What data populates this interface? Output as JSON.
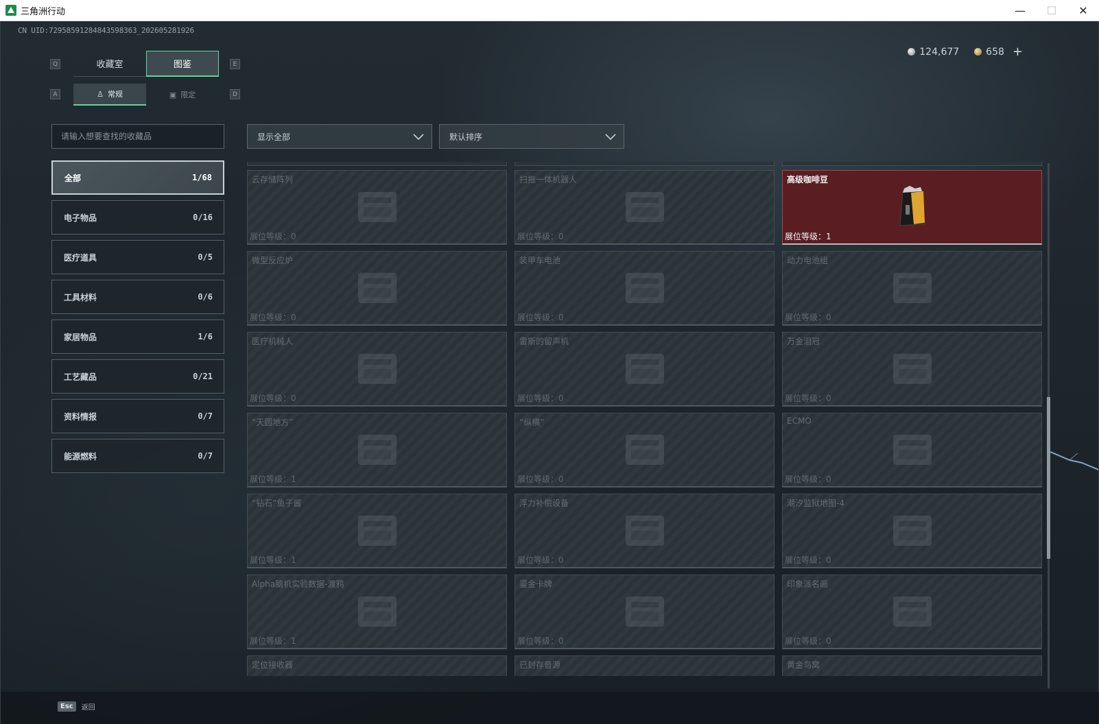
{
  "window": {
    "title": "三角洲行动",
    "minimize": "—",
    "maximize": "☐",
    "close": "✕"
  },
  "uid": "CN UID:72958591284843598363_202605281926",
  "currency": {
    "silver": "124,677",
    "gold": "658",
    "add": "+"
  },
  "keys": {
    "prev_tab": "Q",
    "next_tab": "E",
    "prev_sub": "A",
    "next_sub": "D",
    "back": "Esc"
  },
  "tabs": [
    {
      "label": "收藏室",
      "active": false
    },
    {
      "label": "图鉴",
      "active": true
    }
  ],
  "subtabs": [
    {
      "label": "常规",
      "icon": "figure-icon",
      "active": true
    },
    {
      "label": "限定",
      "icon": "image-icon",
      "active": false
    }
  ],
  "search": {
    "placeholder": "请输入想要查找的收藏品",
    "value": ""
  },
  "filters": {
    "display": "显示全部",
    "sort": "默认排序"
  },
  "categories": [
    {
      "label": "全部",
      "count": "1/68",
      "active": true
    },
    {
      "label": "电子物品",
      "count": "0/16",
      "active": false
    },
    {
      "label": "医疗道具",
      "count": "0/5",
      "active": false
    },
    {
      "label": "工具材料",
      "count": "0/6",
      "active": false
    },
    {
      "label": "家居物品",
      "count": "1/6",
      "active": false
    },
    {
      "label": "工艺藏品",
      "count": "0/21",
      "active": false
    },
    {
      "label": "资料情报",
      "count": "0/7",
      "active": false
    },
    {
      "label": "能源燃料",
      "count": "0/7",
      "active": false
    }
  ],
  "items": [
    {
      "name": "云存储阵列",
      "level": "展位等级：0",
      "owned": false,
      "icon": "server-icon"
    },
    {
      "name": "扫拖一体机器人",
      "level": "展位等级：0",
      "owned": false,
      "icon": "robot-icon"
    },
    {
      "name": "高级咖啡豆",
      "level": "展位等级：1",
      "owned": true,
      "icon": "coffee-bag-icon"
    },
    {
      "name": "微型反应炉",
      "level": "展位等级：0",
      "owned": false,
      "icon": "reactor-icon"
    },
    {
      "name": "装甲车电池",
      "level": "展位等级：0",
      "owned": false,
      "icon": "battery-icon"
    },
    {
      "name": "动力电池组",
      "level": "展位等级：0",
      "owned": false,
      "icon": "battery-pack-icon"
    },
    {
      "name": "医疗机械人",
      "level": "展位等级：0",
      "owned": false,
      "icon": "robot-arm-icon"
    },
    {
      "name": "雷斯的留声机",
      "level": "展位等级：0",
      "owned": false,
      "icon": "gramophone-icon"
    },
    {
      "name": "万金泪冠",
      "level": "展位等级：0",
      "owned": false,
      "icon": "crown-icon"
    },
    {
      "name": "“天圆地方”",
      "level": "展位等级：1",
      "owned": false,
      "icon": "armillary-icon"
    },
    {
      "name": "“纵横”",
      "level": "展位等级：0",
      "owned": false,
      "icon": "chessboard-icon"
    },
    {
      "name": "ECMO",
      "level": "展位等级：0",
      "owned": false,
      "icon": "machine-icon"
    },
    {
      "name": "“钻石”鱼子酱",
      "level": "展位等级：1",
      "owned": false,
      "icon": "caviar-tin-icon"
    },
    {
      "name": "浮力补偿设备",
      "level": "展位等级：0",
      "owned": false,
      "icon": "vest-icon"
    },
    {
      "name": "潮汐监狱地图-4",
      "level": "展位等级：0",
      "owned": false,
      "icon": "map-icon"
    },
    {
      "name": "Alpha脑机实验数据-渡鸦",
      "level": "展位等级：1",
      "owned": false,
      "icon": "drive-icon"
    },
    {
      "name": "鎏金卡牌",
      "level": "展位等级：0",
      "owned": false,
      "icon": "card-icon"
    },
    {
      "name": "印象派名画",
      "level": "展位等级：0",
      "owned": false,
      "icon": "painting-icon"
    }
  ],
  "next_row": [
    {
      "name": "定位接收器"
    },
    {
      "name": "已封存音源"
    },
    {
      "name": "黄金鸟窝"
    }
  ],
  "footer": {
    "back_label": "返回"
  }
}
